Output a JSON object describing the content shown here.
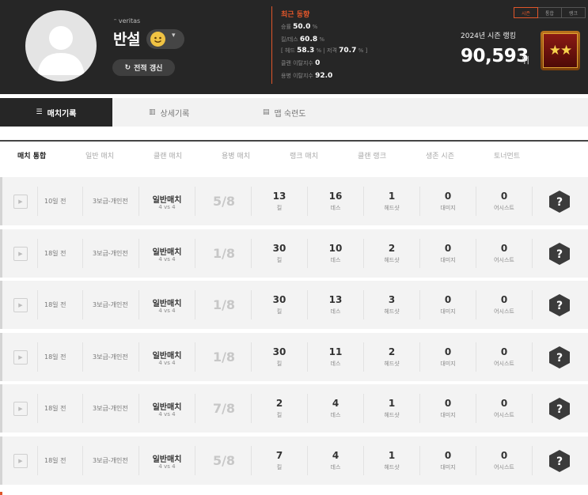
{
  "profile": {
    "prefix": "ᵔ veritas",
    "nickname": "반설",
    "refresh_label": "전적 갱신"
  },
  "recent": {
    "title": "최근 동향",
    "win_rate_label": "승률",
    "win_rate_value": "50.0",
    "kd_label": "킬/데스",
    "kd_value": "60.8",
    "head_label": "헤드",
    "head_value": "58.3",
    "shot_label": "저격",
    "shot_value": "70.7",
    "percent": "%",
    "bracket_open": "[",
    "bracket_close": "]",
    "pipe": "|",
    "clan_leave_label": "클랜 이탈지수",
    "clan_leave_value": "0",
    "merc_leave_label": "용병 이탈지수",
    "merc_leave_value": "92.0"
  },
  "season_tabs": [
    "시즌",
    "통합",
    "랭크"
  ],
  "ranking": {
    "label": "2024년 시즌 랭킹",
    "value": "90,593",
    "suffix": "위",
    "badge": "★★"
  },
  "main_tabs": [
    {
      "label": "매치기록",
      "icon": "list-icon"
    },
    {
      "label": "상세기록",
      "icon": "chart-icon"
    },
    {
      "label": "맵 숙련도",
      "icon": "map-icon"
    }
  ],
  "sub_tabs": [
    "매치 통합",
    "일반 매치",
    "클랜 매치",
    "용병 매치",
    "랭크 매치",
    "클랜 랭크",
    "생존 시즌",
    "토너먼트"
  ],
  "labels": {
    "kill": "킬",
    "death": "데스",
    "headshot": "헤드샷",
    "damage": "대미지",
    "assist": "어시스트",
    "unknown": "?",
    "play": "▶"
  },
  "matches": [
    {
      "time": "10일 전",
      "mode": "3보급-개인전",
      "type": "일반매치",
      "vs": "4 vs 4",
      "place": "5/8",
      "kill": "13",
      "death": "16",
      "headshot": "1",
      "damage": "0",
      "assist": "0"
    },
    {
      "time": "18일 전",
      "mode": "3보급-개인전",
      "type": "일반매치",
      "vs": "4 vs 4",
      "place": "1/8",
      "kill": "30",
      "death": "10",
      "headshot": "2",
      "damage": "0",
      "assist": "0"
    },
    {
      "time": "18일 전",
      "mode": "3보급-개인전",
      "type": "일반매치",
      "vs": "4 vs 4",
      "place": "1/8",
      "kill": "30",
      "death": "13",
      "headshot": "3",
      "damage": "0",
      "assist": "0"
    },
    {
      "time": "18일 전",
      "mode": "3보급-개인전",
      "type": "일반매치",
      "vs": "4 vs 4",
      "place": "1/8",
      "kill": "30",
      "death": "11",
      "headshot": "2",
      "damage": "0",
      "assist": "0"
    },
    {
      "time": "18일 전",
      "mode": "3보급-개인전",
      "type": "일반매치",
      "vs": "4 vs 4",
      "place": "7/8",
      "kill": "2",
      "death": "4",
      "headshot": "1",
      "damage": "0",
      "assist": "0"
    },
    {
      "time": "18일 전",
      "mode": "3보급-개인전",
      "type": "일반매치",
      "vs": "4 vs 4",
      "place": "5/8",
      "kill": "7",
      "death": "4",
      "headshot": "1",
      "damage": "0",
      "assist": "0"
    }
  ],
  "colors": {
    "accent": "#e0562a",
    "header_bg": "#262626",
    "row_bg": "#f3f3f3"
  }
}
